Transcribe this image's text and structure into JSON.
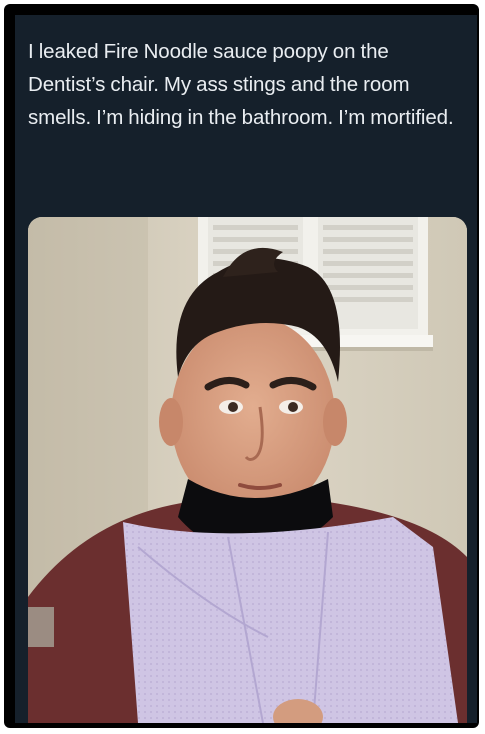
{
  "tweet": {
    "text": "I leaked Fire Noodle sauce poopy on the Dentist’s chair. My ass stings and the room smells. I’m hiding in the bathroom. I’m mortified."
  },
  "photo": {
    "subject": "selfie-photo"
  },
  "colors": {
    "background": "#15202b",
    "text": "#e9edf1",
    "frame": "#000000"
  }
}
